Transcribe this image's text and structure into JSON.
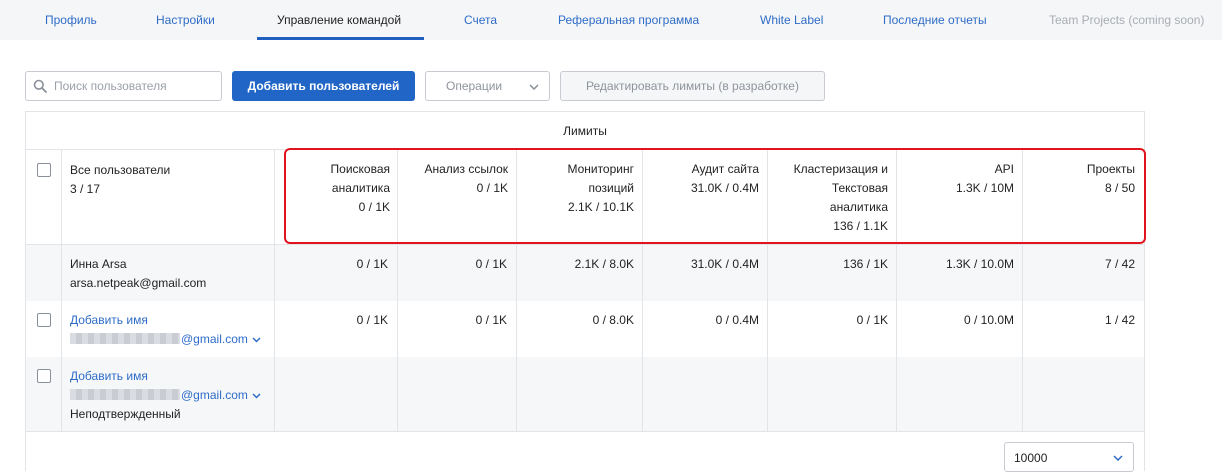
{
  "nav": {
    "tabs": [
      {
        "label": "Профиль"
      },
      {
        "label": "Настройки"
      },
      {
        "label": "Управление командой"
      },
      {
        "label": "Счета"
      },
      {
        "label": "Реферальная программа"
      },
      {
        "label": "White Label"
      },
      {
        "label": "Последние отчеты"
      },
      {
        "label": "Team Projects (coming soon)"
      }
    ],
    "active_tab": "Управление командой"
  },
  "toolbar": {
    "search_placeholder": "Поиск пользователя",
    "add_users_label": "Добавить пользователей",
    "operations_label": "Операции",
    "edit_limits_label": "Редактировать лимиты (в разработке)"
  },
  "table": {
    "limits_title": "Лимиты",
    "all_users_label": "Все пользователи",
    "all_users_count": "3 / 17",
    "columns": [
      {
        "label": "Поисковая аналитика",
        "total": "0 / 1K"
      },
      {
        "label": "Анализ ссылок",
        "total": "0 / 1K"
      },
      {
        "label": "Мониторинг позиций",
        "total": "2.1K / 10.1K"
      },
      {
        "label": "Аудит сайта",
        "total": "31.0K / 0.4M"
      },
      {
        "label": "Кластеризация и Текстовая аналитика",
        "total": "136 / 1.1K"
      },
      {
        "label": "API",
        "total": "1.3K / 10M"
      },
      {
        "label": "Проекты",
        "total": "8 / 50"
      }
    ],
    "rows": [
      {
        "name": "Инна Arsa",
        "email": "arsa.netpeak@gmail.com",
        "values": [
          "0 / 1K",
          "0 / 1K",
          "2.1K / 8.0K",
          "31.0K / 0.4M",
          "136 / 1K",
          "1.3K / 10.0M",
          "7 / 42"
        ]
      },
      {
        "name": "Добавить имя",
        "email_suffix": "@gmail.com",
        "values": [
          "0 / 1K",
          "0 / 1K",
          "0 / 8.0K",
          "0 / 0.4M",
          "0 / 1K",
          "0 / 10.0M",
          "1 / 42"
        ]
      },
      {
        "name": "Добавить имя",
        "email_suffix": "@gmail.com",
        "status": "Неподтвержденный"
      }
    ]
  },
  "pagination": {
    "page_size": "10000"
  },
  "colors": {
    "accent": "#2166c7",
    "link": "#2e6cc7",
    "highlight_box": "#e0131e"
  }
}
